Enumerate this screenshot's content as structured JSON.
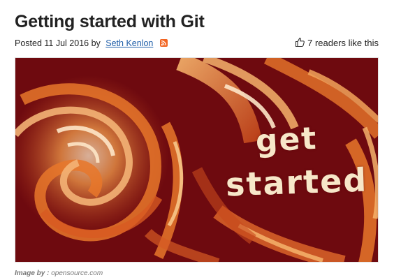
{
  "article": {
    "title": "Getting started with Git",
    "posted_prefix": "Posted 11 Jul 2016 by",
    "author": "Seth Kenlon",
    "likes_text": "7 readers like this"
  },
  "hero": {
    "text_line1": "get",
    "text_line2": "started"
  },
  "credit": {
    "label": "Image by :",
    "source": "opensource.com"
  },
  "icons": {
    "rss": "rss-icon",
    "likes": "thumbs-up-icon"
  },
  "colors": {
    "link": "#1f5ea8",
    "rss": "#f26522",
    "hero_background": "#6e0a0f",
    "hero_swirl": "#e8772a"
  }
}
